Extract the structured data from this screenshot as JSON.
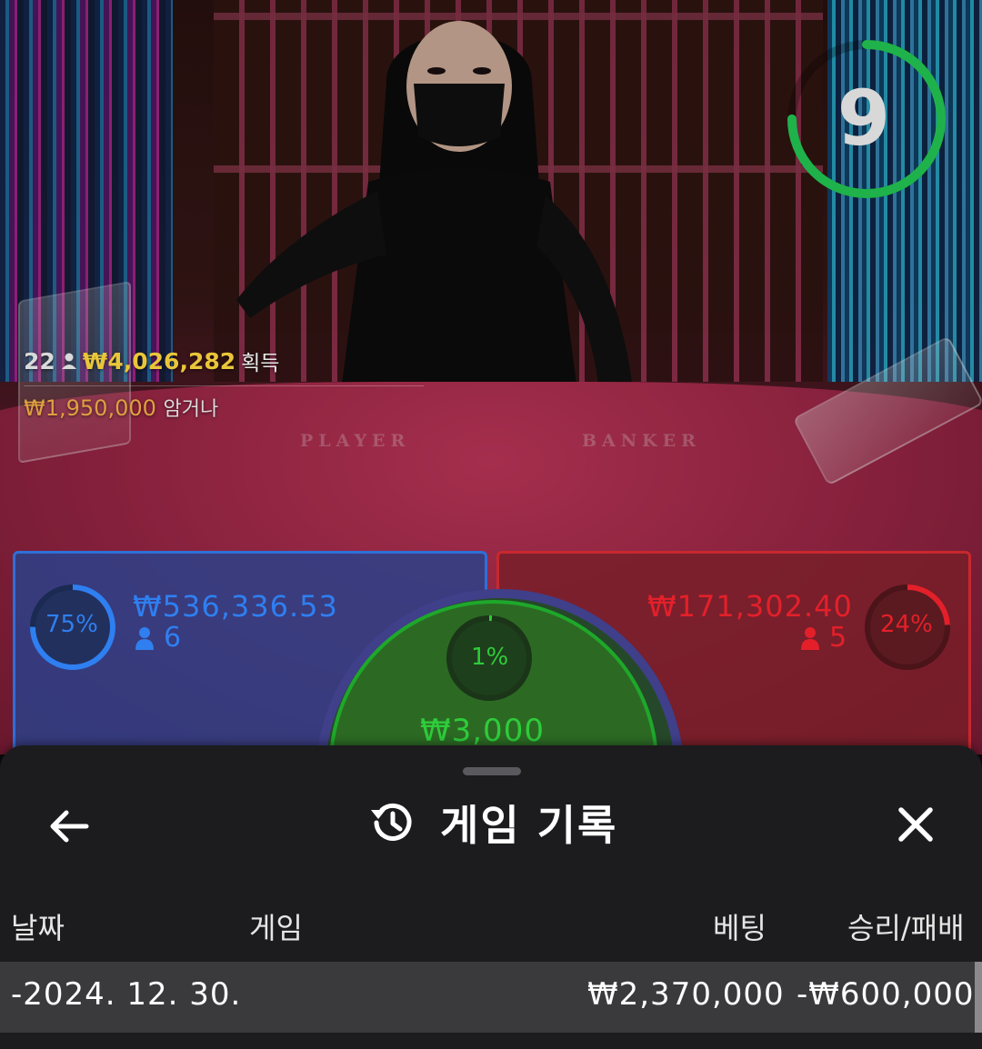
{
  "video": {
    "table_labels": {
      "player": "PLAYER",
      "banker": "BANKER"
    }
  },
  "stats": {
    "player_count": "22",
    "won_amount": "₩4,026,282",
    "won_suffix": "획득",
    "bet_amount": "₩1,950,000",
    "bet_suffix": "암거나"
  },
  "timer": {
    "value": "9",
    "progress": 0.75,
    "color": "#1fb24a"
  },
  "bets": {
    "player": {
      "percent_label": "75%",
      "percent": 75,
      "amount": "₩536,336.53",
      "count": "6",
      "color": "#2f7ff0"
    },
    "banker": {
      "percent_label": "24%",
      "percent": 24,
      "amount": "₩171,302.40",
      "count": "5",
      "color": "#e3202a"
    },
    "tie": {
      "percent_label": "1%",
      "percent": 1,
      "amount": "₩3,000",
      "color": "#2ecc3a"
    }
  },
  "sheet": {
    "title": "게임 기록",
    "icons": {
      "back": "arrow-left-icon",
      "history": "history-icon",
      "close": "close-icon"
    },
    "columns": [
      "날짜",
      "게임",
      "베팅",
      "승리/패배"
    ],
    "rows": [
      {
        "date": "-2024. 12. 30.",
        "game": "",
        "bet": "₩2,370,000",
        "result": "-₩600,000"
      }
    ]
  }
}
